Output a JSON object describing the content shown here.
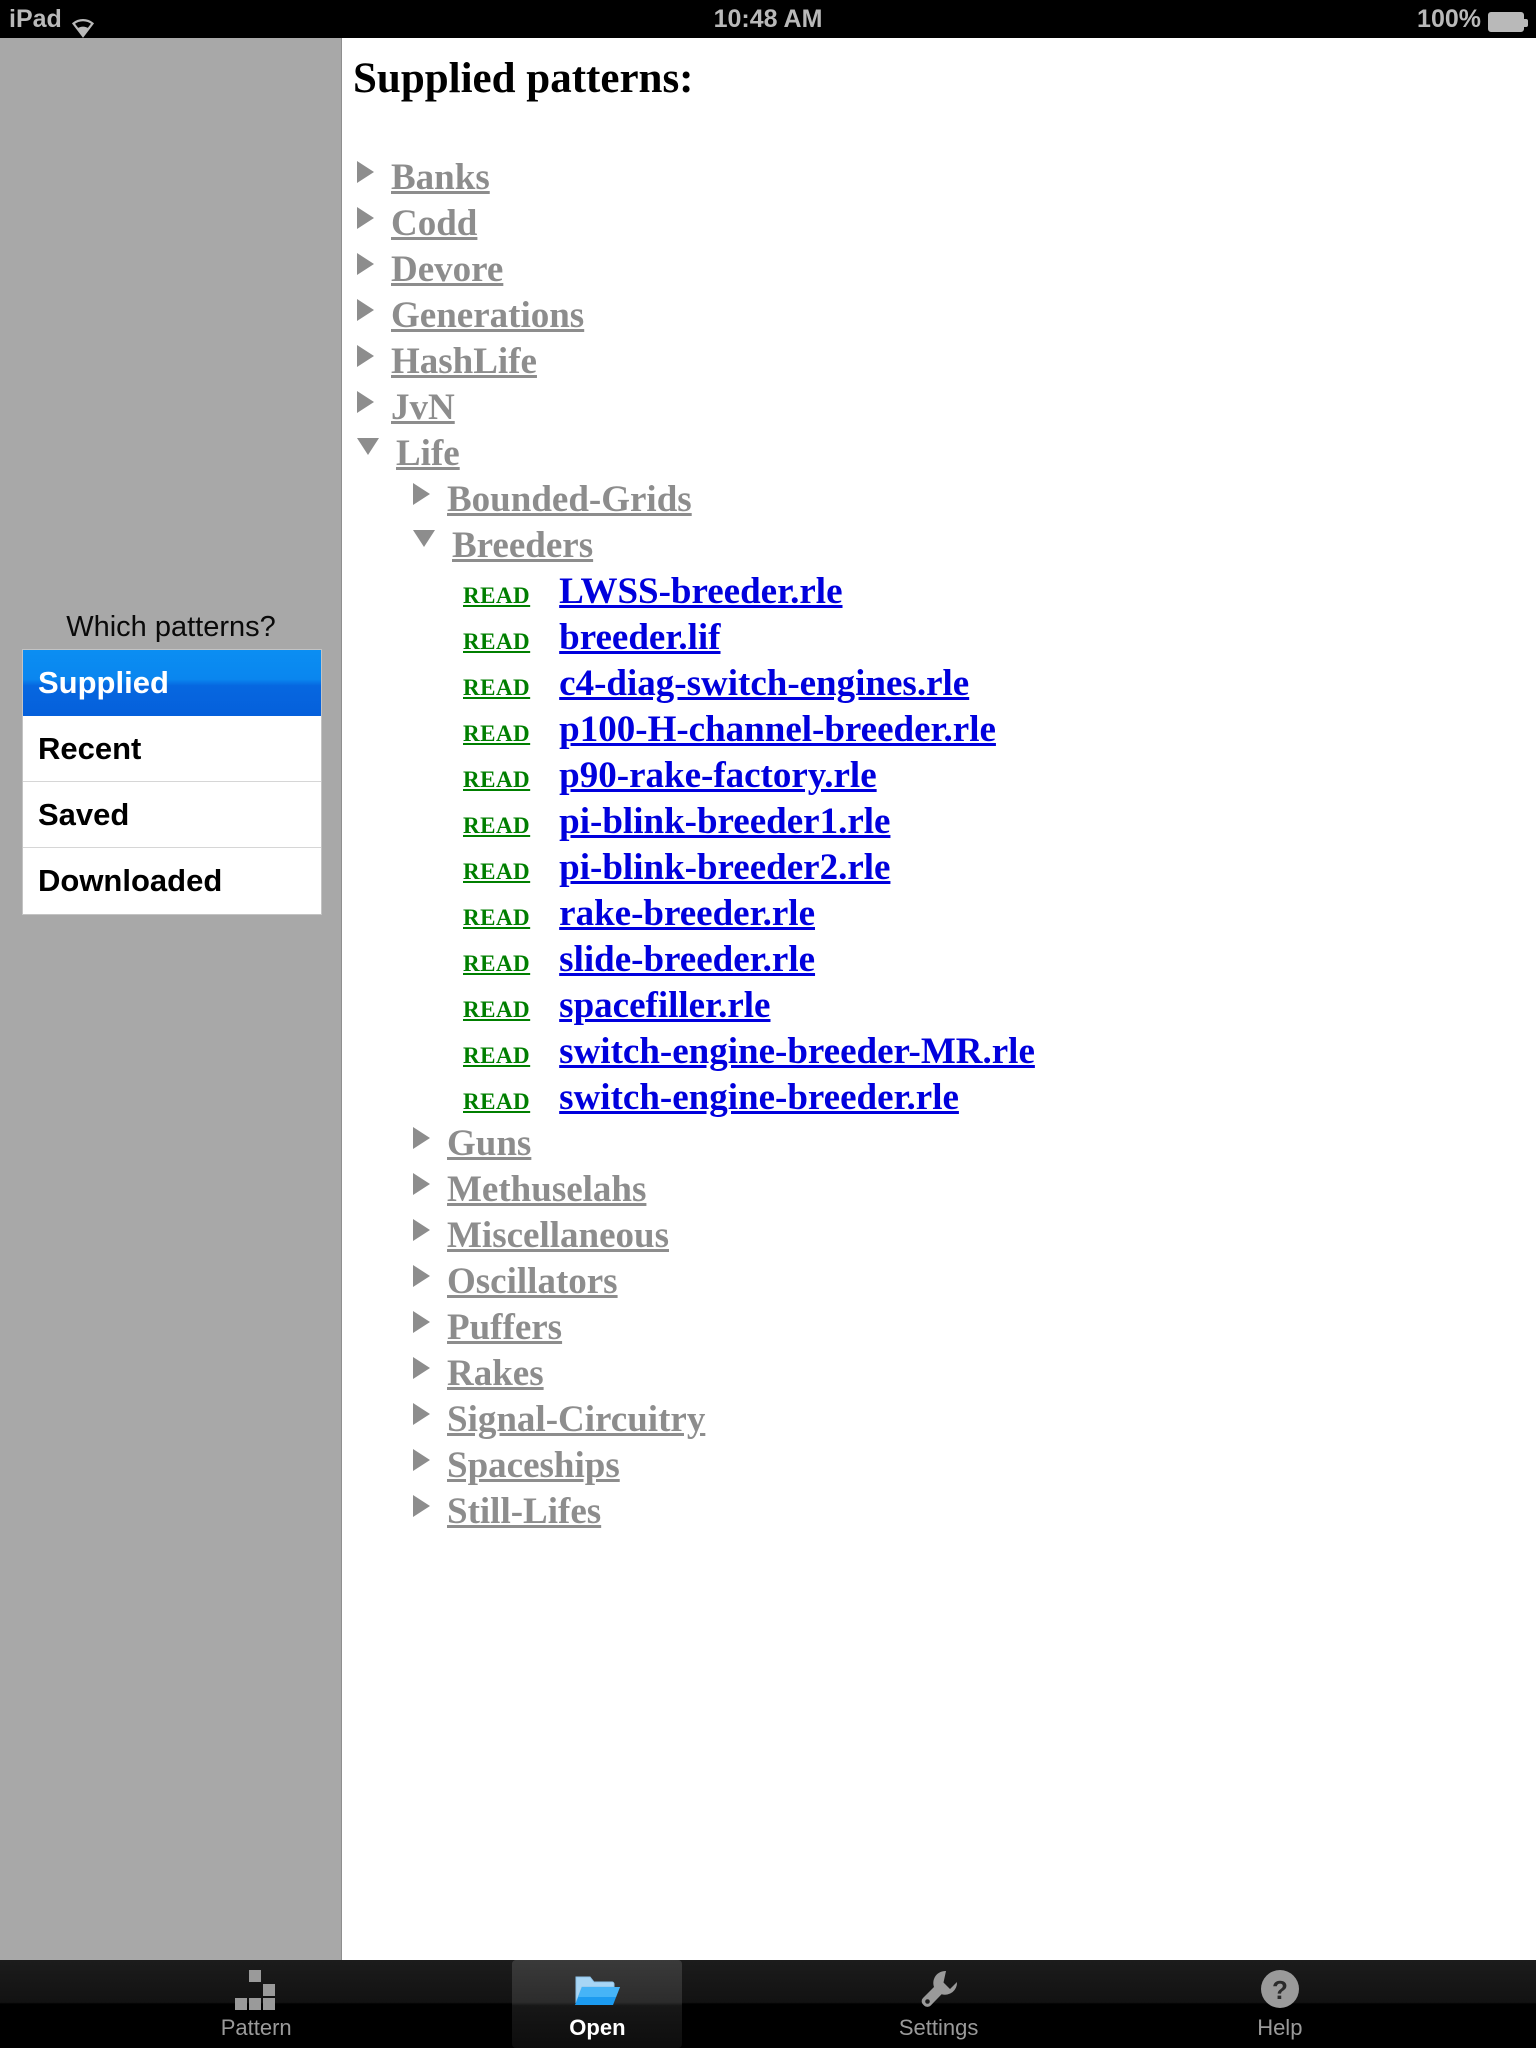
{
  "status_bar": {
    "device": "iPad",
    "wifi_icon": "wifi-icon",
    "time": "10:48 AM",
    "battery_percent": "100%",
    "battery_icon": "battery-full-icon"
  },
  "sidebar": {
    "prompt": "Which patterns?",
    "items": [
      {
        "label": "Supplied",
        "selected": true
      },
      {
        "label": "Recent",
        "selected": false
      },
      {
        "label": "Saved",
        "selected": false
      },
      {
        "label": "Downloaded",
        "selected": false
      }
    ]
  },
  "main": {
    "title": "Supplied patterns:",
    "read_label": "READ",
    "tree": [
      {
        "type": "folder",
        "level": 0,
        "label": "Banks",
        "expanded": false
      },
      {
        "type": "folder",
        "level": 0,
        "label": "Codd",
        "expanded": false
      },
      {
        "type": "folder",
        "level": 0,
        "label": "Devore",
        "expanded": false
      },
      {
        "type": "folder",
        "level": 0,
        "label": "Generations",
        "expanded": false
      },
      {
        "type": "folder",
        "level": 0,
        "label": "HashLife",
        "expanded": false
      },
      {
        "type": "folder",
        "level": 0,
        "label": "JvN",
        "expanded": false
      },
      {
        "type": "folder",
        "level": 0,
        "label": "Life",
        "expanded": true
      },
      {
        "type": "folder",
        "level": 1,
        "label": "Bounded-Grids",
        "expanded": false
      },
      {
        "type": "folder",
        "level": 1,
        "label": "Breeders",
        "expanded": true
      },
      {
        "type": "file",
        "level": 2,
        "label": "LWSS-breeder.rle"
      },
      {
        "type": "file",
        "level": 2,
        "label": "breeder.lif"
      },
      {
        "type": "file",
        "level": 2,
        "label": "c4-diag-switch-engines.rle"
      },
      {
        "type": "file",
        "level": 2,
        "label": "p100-H-channel-breeder.rle"
      },
      {
        "type": "file",
        "level": 2,
        "label": "p90-rake-factory.rle"
      },
      {
        "type": "file",
        "level": 2,
        "label": "pi-blink-breeder1.rle"
      },
      {
        "type": "file",
        "level": 2,
        "label": "pi-blink-breeder2.rle"
      },
      {
        "type": "file",
        "level": 2,
        "label": "rake-breeder.rle"
      },
      {
        "type": "file",
        "level": 2,
        "label": "slide-breeder.rle"
      },
      {
        "type": "file",
        "level": 2,
        "label": "spacefiller.rle"
      },
      {
        "type": "file",
        "level": 2,
        "label": "switch-engine-breeder-MR.rle"
      },
      {
        "type": "file",
        "level": 2,
        "label": "switch-engine-breeder.rle"
      },
      {
        "type": "folder",
        "level": 1,
        "label": "Guns",
        "expanded": false
      },
      {
        "type": "folder",
        "level": 1,
        "label": "Methuselahs",
        "expanded": false
      },
      {
        "type": "folder",
        "level": 1,
        "label": "Miscellaneous",
        "expanded": false
      },
      {
        "type": "folder",
        "level": 1,
        "label": "Oscillators",
        "expanded": false
      },
      {
        "type": "folder",
        "level": 1,
        "label": "Puffers",
        "expanded": false
      },
      {
        "type": "folder",
        "level": 1,
        "label": "Rakes",
        "expanded": false
      },
      {
        "type": "folder",
        "level": 1,
        "label": "Signal-Circuitry",
        "expanded": false
      },
      {
        "type": "folder",
        "level": 1,
        "label": "Spaceships",
        "expanded": false
      },
      {
        "type": "folder",
        "level": 1,
        "label": "Still-Lifes",
        "expanded": false
      }
    ]
  },
  "tabbar": {
    "tabs": [
      {
        "label": "Pattern",
        "icon": "glider-icon",
        "selected": false
      },
      {
        "label": "Open",
        "icon": "folder-icon",
        "selected": true
      },
      {
        "label": "Settings",
        "icon": "wrench-icon",
        "selected": false
      },
      {
        "label": "Help",
        "icon": "question-icon",
        "selected": false
      }
    ]
  },
  "colors": {
    "selection_blue": "#0a86ef",
    "folder_gray": "#8d8d8d",
    "file_blue": "#0000dd",
    "read_green": "#007f00",
    "sidebar_gray": "#a8a8a8"
  }
}
